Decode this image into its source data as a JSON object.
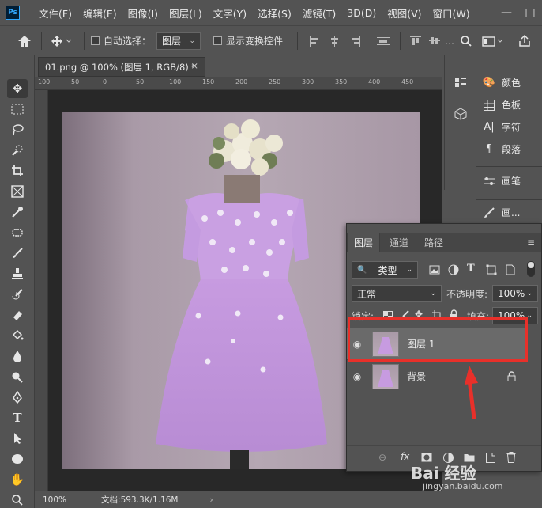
{
  "app": {
    "logo": "Ps"
  },
  "menu": [
    "文件(F)",
    "编辑(E)",
    "图像(I)",
    "图层(L)",
    "文字(Y)",
    "选择(S)",
    "滤镜(T)",
    "3D(D)",
    "视图(V)",
    "窗口(W)"
  ],
  "window_controls": {
    "minimize": "—",
    "maximize": "□"
  },
  "options": {
    "auto_select_label": "自动选择：",
    "auto_select_checked": false,
    "auto_select_target": "图层",
    "show_transform_label": "显示变换控件",
    "show_transform_checked": false
  },
  "document": {
    "tab_title": "01.png @ 100% (图层 1, RGB/8) *",
    "ruler_labels": [
      "100",
      "50",
      "0",
      "50",
      "100",
      "150",
      "200",
      "250",
      "300",
      "350",
      "400",
      "450"
    ],
    "ruler_v_labels": [
      "5",
      "0",
      "5",
      "0",
      "1",
      "0",
      "0",
      "1",
      "5",
      "0",
      "2",
      "0",
      "0",
      "2",
      "5",
      "0",
      "3",
      "0",
      "0"
    ]
  },
  "status": {
    "zoom": "100%",
    "doc_size": "文档:593.3K/1.16M"
  },
  "panels": {
    "color": "颜色",
    "swatches": "色板",
    "character": "字符",
    "paragraph": "段落",
    "brush": "画笔",
    "brush_settings": "画..."
  },
  "layers_panel": {
    "tabs": [
      "图层",
      "通道",
      "路径"
    ],
    "active_tab": "图层",
    "filter_kind": "类型",
    "blend_mode": "正常",
    "opacity_label": "不透明度:",
    "opacity": "100%",
    "lock_label": "锁定:",
    "fill_label": "填充:",
    "fill": "100%",
    "layers": [
      {
        "name": "图层 1",
        "selected": true,
        "visible": true,
        "locked": false
      },
      {
        "name": "背景",
        "selected": false,
        "visible": true,
        "locked": true
      }
    ],
    "footer_icons": [
      "link-icon",
      "fx-icon",
      "mask-icon",
      "adjustment-icon",
      "group-icon",
      "new-layer-icon",
      "trash-icon"
    ]
  },
  "annotation": {
    "highlight_color": "#e8302a"
  },
  "watermark": {
    "text": "Bai 经验",
    "url": "jingyan.baidu.com"
  }
}
